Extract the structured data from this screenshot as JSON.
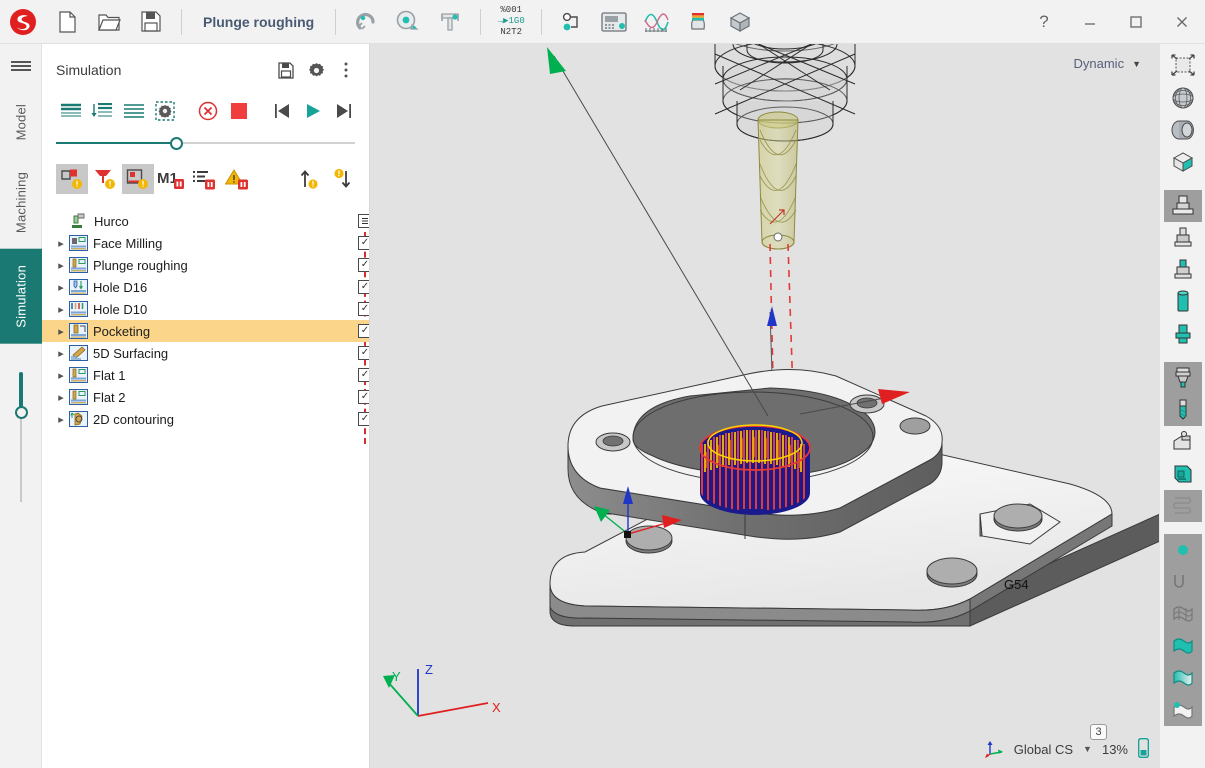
{
  "titlebar": {
    "logo_name": "sescoi-logo",
    "buttons": [
      {
        "name": "new-document-button",
        "icon": "new-file-icon",
        "label": "New"
      },
      {
        "name": "open-document-button",
        "icon": "open-folder-icon",
        "label": "Open"
      },
      {
        "name": "save-document-button",
        "icon": "save-disk-icon",
        "label": "Save"
      }
    ],
    "document_title": "Plunge roughing",
    "tools": [
      {
        "name": "magnet-measure-button",
        "icon": "magnet-icon",
        "label": "Magnet"
      },
      {
        "name": "tape-measure-button",
        "icon": "tape-measure-icon",
        "label": "Measure"
      },
      {
        "name": "caliper-button",
        "icon": "caliper-icon",
        "label": "Caliper"
      },
      {
        "name": "nc-code-button",
        "icon": "nc-code-icon",
        "label": "NC code"
      },
      {
        "name": "machine-link-button",
        "icon": "node-link-icon",
        "label": "Machine link"
      },
      {
        "name": "control-panel-button",
        "icon": "control-panel-icon",
        "label": "Control panel"
      },
      {
        "name": "feed-graph-button",
        "icon": "feed-graph-icon",
        "label": "Feed graph"
      },
      {
        "name": "material-stack-button",
        "icon": "material-stack-icon",
        "label": "Material"
      },
      {
        "name": "stock-box-button",
        "icon": "stock-box-icon",
        "label": "Stock"
      }
    ],
    "nc_code": {
      "line1": "%001",
      "line2": "1G0",
      "line3": "N2T2"
    },
    "window": {
      "help": "?",
      "minimize": "—",
      "maximize": "□",
      "close": "✕"
    }
  },
  "rail": {
    "menu_label": "menu",
    "tabs": [
      {
        "name": "rail-tab-model",
        "label": "Model",
        "active": false
      },
      {
        "name": "rail-tab-machining",
        "label": "Machining",
        "active": false
      },
      {
        "name": "rail-tab-simulation",
        "label": "Simulation",
        "active": true
      }
    ]
  },
  "panel": {
    "title": "Simulation",
    "header_buttons": [
      {
        "name": "panel-save-button",
        "icon": "save-disk-icon"
      },
      {
        "name": "panel-settings-button",
        "icon": "gear-icon"
      },
      {
        "name": "panel-more-button",
        "icon": "kebab-menu-icon"
      }
    ],
    "playback": [
      {
        "name": "sim-mode-block-button",
        "icon": "lines-block-icon",
        "label": "Block mode"
      },
      {
        "name": "sim-step-down-button",
        "icon": "lines-step-icon",
        "label": "Step"
      },
      {
        "name": "sim-continuous-button",
        "icon": "lines-continuous-icon",
        "label": "Continuous"
      },
      {
        "name": "sim-collision-button",
        "icon": "dashed-gear-icon",
        "label": "Collision check"
      },
      {
        "name": "sim-abort-button",
        "icon": "cancel-circle-icon",
        "label": "Abort"
      },
      {
        "name": "sim-stop-button",
        "icon": "stop-square-icon",
        "label": "Stop"
      },
      {
        "name": "sim-rewind-button",
        "icon": "skip-previous-icon",
        "label": "Rewind"
      },
      {
        "name": "sim-play-button",
        "icon": "play-icon",
        "label": "Play"
      },
      {
        "name": "sim-forward-button",
        "icon": "skip-next-icon",
        "label": "Forward"
      }
    ],
    "progress": {
      "name": "simulation-progress-slider",
      "percent": 40
    },
    "view_toggles": [
      {
        "name": "toggle-stock-view-button",
        "icon": "stock-warning-icon",
        "active": true
      },
      {
        "name": "toggle-fixture-view-button",
        "icon": "fixture-warning-icon",
        "active": false
      },
      {
        "name": "toggle-machine-view-button",
        "icon": "machine-warning-icon",
        "active": true
      },
      {
        "name": "m1-stop-button",
        "icon": "m1-pause-icon",
        "label": "M1",
        "active": false
      },
      {
        "name": "program-list-button",
        "icon": "list-pause-icon",
        "active": false
      },
      {
        "name": "warnings-button",
        "icon": "warning-pause-icon",
        "active": false
      },
      {
        "name": "step-up-button",
        "icon": "arrow-up-warning-icon",
        "active": false
      },
      {
        "name": "step-down-button",
        "icon": "arrow-down-warning-icon",
        "active": false
      }
    ]
  },
  "tree": {
    "root": {
      "name": "tree-root-hurco",
      "label": "Hurco",
      "icon": "machine-icon"
    },
    "items": [
      {
        "name": "tree-item-face-milling",
        "label": "Face Milling",
        "icon": "face-mill-icon",
        "checked": true,
        "color": "#8c1313",
        "selected": false
      },
      {
        "name": "tree-item-plunge-roughing",
        "label": "Plunge roughing",
        "icon": "plunge-mill-icon",
        "checked": true,
        "color": "#1a8a1a",
        "selected": false
      },
      {
        "name": "tree-item-hole-d16",
        "label": "Hole D16",
        "icon": "drill-icon",
        "checked": true,
        "color": "#1a1a9e",
        "selected": false
      },
      {
        "name": "tree-item-hole-d10",
        "label": "Hole D10",
        "icon": "drill-multi-icon",
        "checked": true,
        "color": "#1a1a9e",
        "selected": false
      },
      {
        "name": "tree-item-pocketing",
        "label": "Pocketing",
        "icon": "pocket-icon",
        "checked": true,
        "color": "#7a7a12",
        "selected": true
      },
      {
        "name": "tree-item-5d-surfacing",
        "label": "5D Surfacing",
        "icon": "surfacing-icon",
        "checked": true,
        "color": "#808080",
        "selected": false
      },
      {
        "name": "tree-item-flat-1",
        "label": "Flat 1",
        "icon": "flat-mill-icon",
        "checked": true,
        "color": "#13e8e8",
        "selected": false
      },
      {
        "name": "tree-item-flat-2",
        "label": "Flat 2",
        "icon": "flat-mill-icon",
        "checked": true,
        "color": "#13e813",
        "selected": false
      },
      {
        "name": "tree-item-2d-contouring",
        "label": "2D contouring",
        "icon": "contour-icon",
        "checked": true,
        "color": "#128080",
        "selected": false
      }
    ],
    "check_glyph": "✓"
  },
  "viewport": {
    "view_mode": {
      "name": "view-mode-dropdown",
      "value": "Dynamic"
    },
    "origin_label": "G54",
    "axes": {
      "x": "X",
      "y": "Y",
      "z": "Z"
    },
    "status": {
      "cs_icon": "coordinate-system-icon",
      "cs_value": "Global CS",
      "zoom_value": "13%",
      "badge_count": "3"
    }
  },
  "right_toolbar": {
    "groups": [
      [
        {
          "name": "fit-view-button",
          "icon": "fit-to-view-icon",
          "active": false
        },
        {
          "name": "wireframe-button",
          "icon": "wireframe-sphere-icon",
          "active": false
        },
        {
          "name": "shaded-button",
          "icon": "shaded-solid-icon",
          "active": false
        },
        {
          "name": "section-box-button",
          "icon": "section-cube-icon",
          "active": false
        }
      ],
      [
        {
          "name": "show-machine-button",
          "icon": "machine-body-icon",
          "active": true
        },
        {
          "name": "show-head-button",
          "icon": "spindle-head-icon",
          "active": false
        },
        {
          "name": "show-holder-button",
          "icon": "tool-holder-icon",
          "active": false
        },
        {
          "name": "show-stock-button",
          "icon": "stock-cylinder-icon",
          "active": false
        },
        {
          "name": "show-part-button",
          "icon": "part-cylinder-icon",
          "active": false
        }
      ],
      [
        {
          "name": "show-tool-assembly-button",
          "icon": "tool-assembly-icon",
          "active": true
        },
        {
          "name": "show-tool-button",
          "icon": "endmill-icon",
          "active": true
        },
        {
          "name": "show-fixture-button",
          "icon": "fixture-icon",
          "active": false
        },
        {
          "name": "show-table-button",
          "icon": "table-icon",
          "active": false
        },
        {
          "name": "show-toolpath-button",
          "icon": "toolpath-icon",
          "active": true
        }
      ],
      [
        {
          "name": "point-display-button",
          "icon": "point-dot-icon",
          "active": true
        },
        {
          "name": "curve-display-button",
          "icon": "curve-icon",
          "active": true
        },
        {
          "name": "mesh-display-button",
          "icon": "mesh-surface-icon",
          "active": true
        },
        {
          "name": "surface-teal-button",
          "icon": "surface-filled-icon",
          "active": true
        },
        {
          "name": "surface-shaded-button",
          "icon": "surface-shaded-icon",
          "active": true
        },
        {
          "name": "surface-point-button",
          "icon": "surface-point-icon",
          "active": true
        }
      ]
    ]
  }
}
